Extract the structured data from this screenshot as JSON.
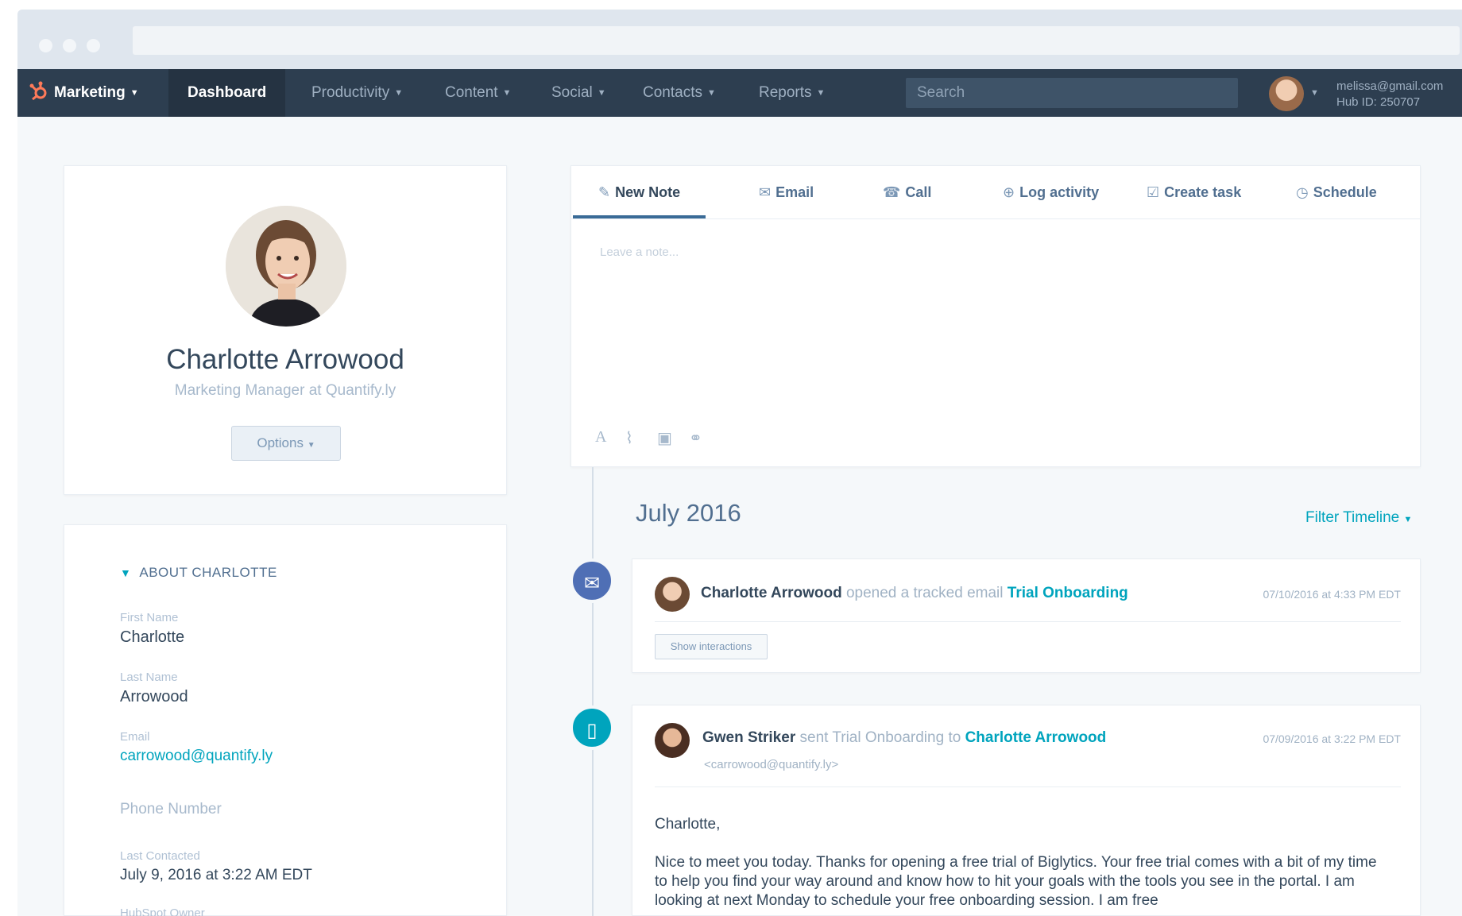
{
  "nav": {
    "brand": "Marketing",
    "items": [
      "Dashboard",
      "Productivity",
      "Content",
      "Social",
      "Contacts",
      "Reports"
    ],
    "search_placeholder": "Search",
    "account_email": "melissa@gmail.com",
    "hub_id": "Hub ID: 250707"
  },
  "profile": {
    "name": "Charlotte Arrowood",
    "title": "Marketing Manager at Quantify.ly",
    "options_label": "Options"
  },
  "about": {
    "heading": "ABOUT CHARLOTTE",
    "first_name_label": "First Name",
    "first_name": "Charlotte",
    "last_name_label": "Last Name",
    "last_name": "Arrowood",
    "email_label": "Email",
    "email": "carrowood@quantify.ly",
    "phone_label": "Phone Number",
    "last_contacted_label": "Last Contacted",
    "last_contacted": "July 9, 2016 at 3:22 AM EDT",
    "owner_label": "HubSpot Owner"
  },
  "composer": {
    "tabs": [
      "New Note",
      "Email",
      "Call",
      "Log activity",
      "Create task",
      "Schedule"
    ],
    "placeholder": "Leave a note..."
  },
  "timeline": {
    "month": "July 2016",
    "filter_label": "Filter Timeline",
    "event1": {
      "actor": "Charlotte Arrowood",
      "action": "opened a tracked email",
      "subject": "Trial Onboarding",
      "date": "07/10/2016 at 4:33 PM EDT",
      "button": "Show interactions"
    },
    "event2": {
      "actor": "Gwen Striker",
      "action_a": "sent Trial Onboarding to",
      "recipient": "Charlotte Arrowood",
      "recipient_email": "<carrowood@quantify.ly>",
      "date": "07/09/2016 at 3:22 PM EDT",
      "greeting": "Charlotte,",
      "body": "Nice to meet you today.  Thanks for opening a free trial of Biglytics.  Your free trial comes with a bit of my time to help you find your way around and know how to hit your goals with the tools you see in the portal.  I am looking at next Monday to schedule your free onboarding session.  I am free"
    }
  }
}
